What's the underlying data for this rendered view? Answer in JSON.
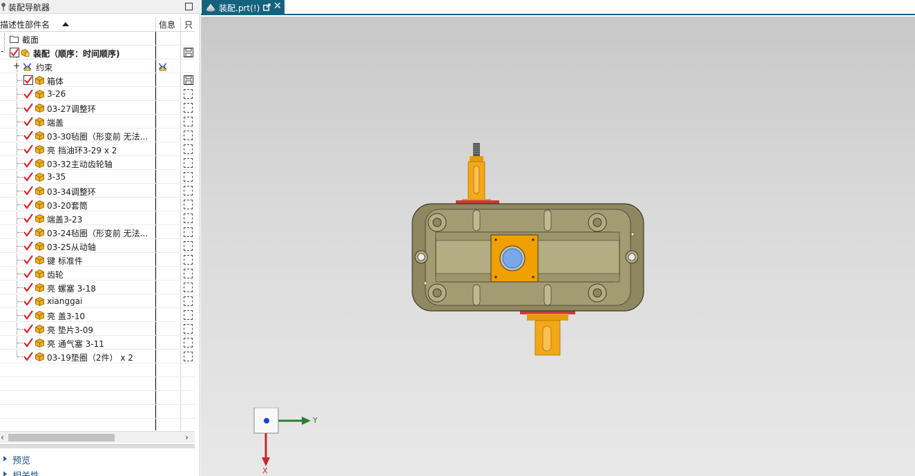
{
  "navigator": {
    "title": "装配导航器",
    "columns": {
      "name": "描述性部件名",
      "info": "信息",
      "readonly": "只"
    },
    "rows": [
      {
        "label": "截面",
        "kind": "folder"
      },
      {
        "label": "装配（顺序：时间顺序)",
        "kind": "assembly"
      },
      {
        "label": "约束",
        "kind": "constraint"
      },
      {
        "label": "箱体",
        "kind": "part-boxed"
      },
      {
        "label": "3-26",
        "kind": "part"
      },
      {
        "label": "03-27调整环",
        "kind": "part"
      },
      {
        "label": "端盖",
        "kind": "part"
      },
      {
        "label": "03-30毡圈（形变前 无法...",
        "kind": "part"
      },
      {
        "label": "亮 挡油环3-29 x 2",
        "kind": "part"
      },
      {
        "label": "03-32主动齿轮轴",
        "kind": "part"
      },
      {
        "label": "3-35",
        "kind": "part"
      },
      {
        "label": "03-34调整环",
        "kind": "part"
      },
      {
        "label": "03-20套筒",
        "kind": "part"
      },
      {
        "label": "端盖3-23",
        "kind": "part"
      },
      {
        "label": "03-24毡圈（形变前 无法...",
        "kind": "part"
      },
      {
        "label": "03-25从动轴",
        "kind": "part"
      },
      {
        "label": "键 标准件",
        "kind": "part"
      },
      {
        "label": "齿轮",
        "kind": "part"
      },
      {
        "label": "亮 螺塞 3-18",
        "kind": "part"
      },
      {
        "label": "xianggai",
        "kind": "part"
      },
      {
        "label": "亮 盖3-10",
        "kind": "part"
      },
      {
        "label": "亮 垫片3-09",
        "kind": "part"
      },
      {
        "label": "亮 通气塞 3-11",
        "kind": "part"
      },
      {
        "label": "03-19垫圈（2件） x 2",
        "kind": "part"
      }
    ],
    "expand_collapsed": "+",
    "expand_expanded": "-",
    "scroll_left": "‹",
    "scroll_right": "›",
    "sections": {
      "preview": "预览",
      "dependencies": "相关性"
    }
  },
  "tab": {
    "label": "装配.prt(!)",
    "close": "✕"
  },
  "triad": {
    "x": "X",
    "y": "Y"
  },
  "colors": {
    "tab_bg": "#13627e",
    "check": "#e02020",
    "housing": "#8e8760",
    "plate": "#f0a000",
    "shaft": "#f2a818",
    "seal": "#c83a3a",
    "boss": "#7aa7e8"
  }
}
